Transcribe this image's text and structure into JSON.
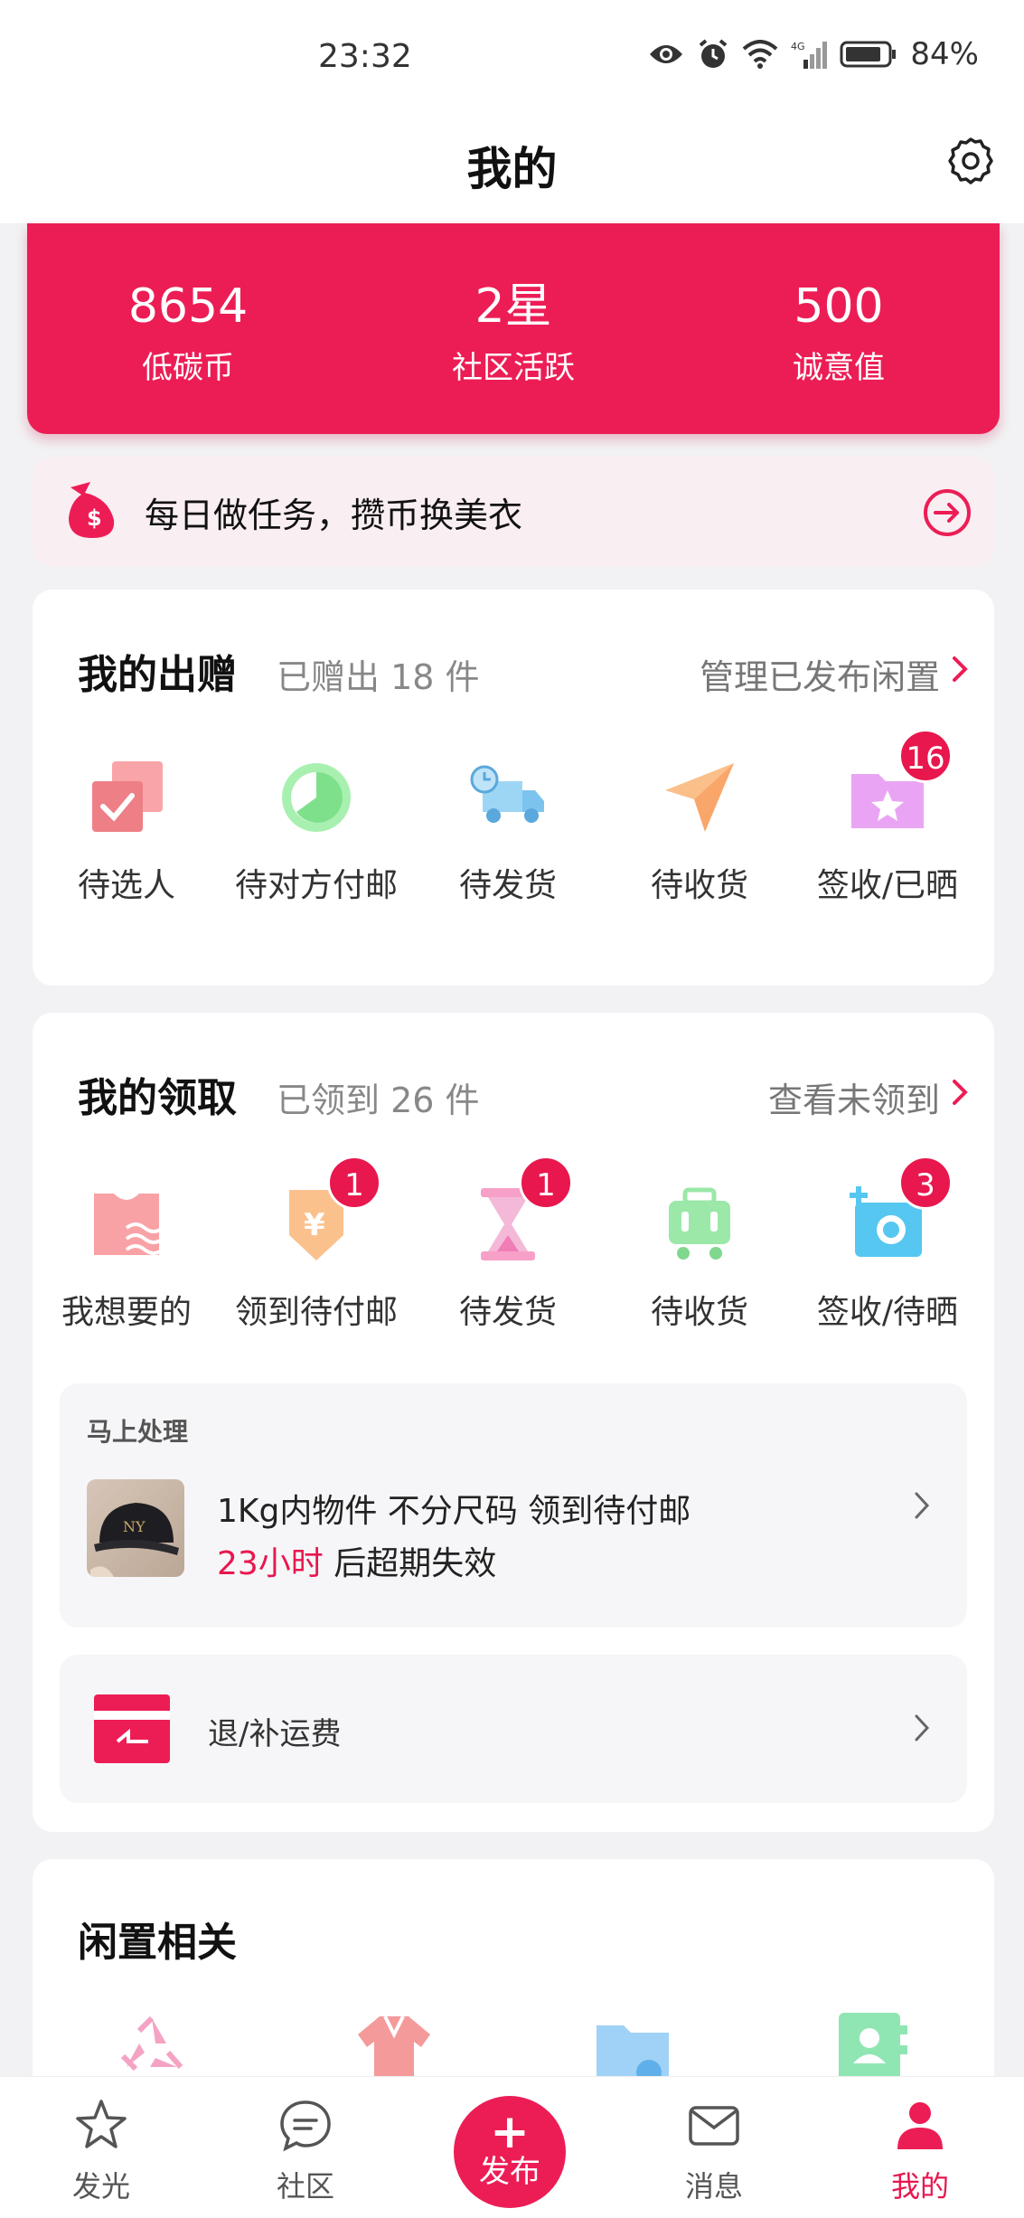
{
  "status_bar": {
    "time": "23:32",
    "battery": "84%",
    "network": "4G"
  },
  "header": {
    "title": "我的"
  },
  "stats": [
    {
      "value": "8654",
      "label": "低碳币"
    },
    {
      "value": "2星",
      "label": "社区活跃"
    },
    {
      "value": "500",
      "label": "诚意值"
    }
  ],
  "banner": {
    "text": "每日做任务，攒币换美衣"
  },
  "donations": {
    "title": "我的出赠",
    "subtitle": "已赠出 18 件",
    "link": "管理已发布闲置",
    "items": [
      {
        "label": "待选人",
        "badge": ""
      },
      {
        "label": "待对方付邮",
        "badge": ""
      },
      {
        "label": "待发货",
        "badge": ""
      },
      {
        "label": "待收货",
        "badge": ""
      },
      {
        "label": "签收/已晒",
        "badge": "16"
      }
    ]
  },
  "receipts": {
    "title": "我的领取",
    "subtitle": "已领到 26 件",
    "link": "查看未领到",
    "items": [
      {
        "label": "我想要的",
        "badge": ""
      },
      {
        "label": "领到待付邮",
        "badge": "1"
      },
      {
        "label": "待发货",
        "badge": "1"
      },
      {
        "label": "待收货",
        "badge": ""
      },
      {
        "label": "签收/待晒",
        "badge": "3"
      }
    ],
    "pending": {
      "heading": "马上处理",
      "description": "1Kg内物件 不分尺码 领到待付邮",
      "time_highlight": "23小时",
      "time_suffix": " 后超期失效"
    },
    "shipping": {
      "label": "退/补运费"
    }
  },
  "idle": {
    "title": "闲置相关"
  },
  "tabs": [
    {
      "label": "发光"
    },
    {
      "label": "社区"
    },
    {
      "label": "发布"
    },
    {
      "label": "消息"
    },
    {
      "label": "我的"
    }
  ],
  "colors": {
    "accent": "#ec1d55"
  }
}
